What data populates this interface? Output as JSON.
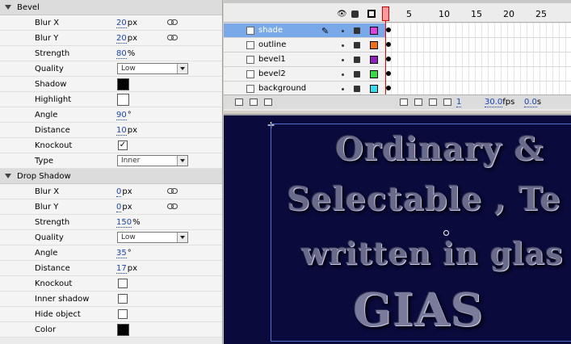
{
  "filters": {
    "bevel": {
      "title": "Bevel",
      "props": [
        {
          "label": "Blur X",
          "value": "20",
          "unit": "px",
          "linked": true
        },
        {
          "label": "Blur Y",
          "value": "20",
          "unit": "px",
          "linked": true
        },
        {
          "label": "Strength",
          "value": "80",
          "unit": "%"
        },
        {
          "label": "Quality",
          "select": "Low"
        },
        {
          "label": "Shadow",
          "color": "#000000"
        },
        {
          "label": "Highlight",
          "color": "#ffffff"
        },
        {
          "label": "Angle",
          "value": "90",
          "unit": "°"
        },
        {
          "label": "Distance",
          "value": "10",
          "unit": "px"
        },
        {
          "label": "Knockout",
          "checkbox": true
        },
        {
          "label": "Type",
          "select": "Inner"
        }
      ]
    },
    "drop_shadow": {
      "title": "Drop Shadow",
      "props": [
        {
          "label": "Blur X",
          "value": "0",
          "unit": "px",
          "linked": true
        },
        {
          "label": "Blur Y",
          "value": "0",
          "unit": "px",
          "linked": true
        },
        {
          "label": "Strength",
          "value": "150",
          "unit": "%"
        },
        {
          "label": "Quality",
          "select": "Low"
        },
        {
          "label": "Angle",
          "value": "35",
          "unit": "°"
        },
        {
          "label": "Distance",
          "value": "17",
          "unit": "px"
        },
        {
          "label": "Knockout",
          "checkbox": false
        },
        {
          "label": "Inner shadow",
          "checkbox": false
        },
        {
          "label": "Hide object",
          "checkbox": false
        },
        {
          "label": "Color",
          "color": "#000000"
        }
      ]
    }
  },
  "timeline": {
    "frame_numbers": [
      "5",
      "10",
      "15",
      "20",
      "25"
    ],
    "layers": [
      {
        "name": "shade",
        "color": "#e040e0",
        "selected": true
      },
      {
        "name": "outline",
        "color": "#f07010"
      },
      {
        "name": "bevel1",
        "color": "#9020c0"
      },
      {
        "name": "bevel2",
        "color": "#30e040"
      },
      {
        "name": "background",
        "color": "#30e0f0"
      }
    ],
    "current_frame": "1",
    "fps": "30.0",
    "fps_unit": "fps",
    "elapsed": "0.0",
    "elapsed_unit": "s"
  },
  "stage": {
    "lines": [
      "Ordinary &",
      "Selectable , Te",
      "written in glas"
    ],
    "glassy_text": "GIAS"
  }
}
